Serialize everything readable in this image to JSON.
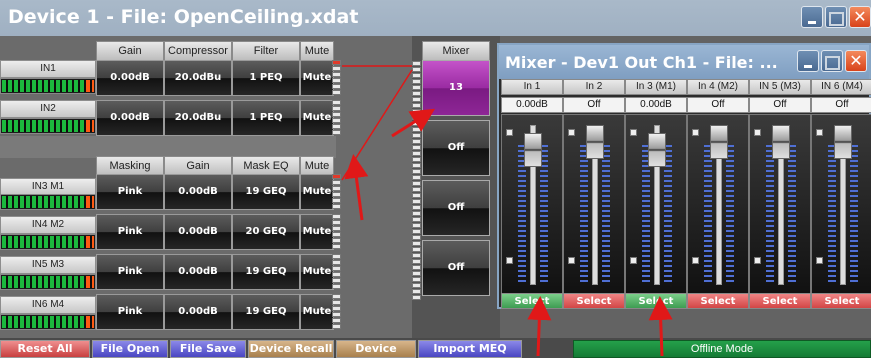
{
  "window": {
    "title": "Device 1  -  File: OpenCeiling.xdat"
  },
  "top_headers": {
    "gain": "Gain",
    "compressor": "Compressor",
    "filter": "Filter",
    "mute": "Mute",
    "mixer": "Mixer"
  },
  "mask_headers": {
    "masking": "Masking",
    "gain": "Gain",
    "mask_eq": "Mask EQ",
    "mute": "Mute"
  },
  "inputs": [
    {
      "name": "IN1",
      "gain": "0.00dB",
      "compressor": "20.0dBu",
      "filter": "1 PEQ",
      "mute": "Mute"
    },
    {
      "name": "IN2",
      "gain": "0.00dB",
      "compressor": "20.0dBu",
      "filter": "1 PEQ",
      "mute": "Mute"
    }
  ],
  "mask_inputs": [
    {
      "name": "IN3 M1",
      "masking": "Pink",
      "gain": "0.00dB",
      "mask_eq": "19 GEQ",
      "mute": "Mute"
    },
    {
      "name": "IN4 M2",
      "masking": "Pink",
      "gain": "0.00dB",
      "mask_eq": "20 GEQ",
      "mute": "Mute"
    },
    {
      "name": "IN5 M3",
      "masking": "Pink",
      "gain": "0.00dB",
      "mask_eq": "19 GEQ",
      "mute": "Mute"
    },
    {
      "name": "IN6 M4",
      "masking": "Pink",
      "gain": "0.00dB",
      "mask_eq": "19 GEQ",
      "mute": "Mute"
    }
  ],
  "mixer_cells": [
    "13",
    "Off",
    "Off",
    "Off"
  ],
  "mixer_window": {
    "title": "Mixer - Dev1 Out Ch1  -  File: ...",
    "strips": [
      {
        "name": "In 1",
        "value": "0.00dB",
        "select": "Select",
        "select_color": "green",
        "level": 0.9
      },
      {
        "name": "In 2",
        "value": "Off",
        "select": "Select",
        "select_color": "red",
        "level": 0.96
      },
      {
        "name": "In 3 (M1)",
        "value": "0.00dB",
        "select": "Select",
        "select_color": "green",
        "level": 0.9
      },
      {
        "name": "In 4 (M2)",
        "value": "Off",
        "select": "Select",
        "select_color": "red",
        "level": 0.96
      },
      {
        "name": "IN 5 (M3)",
        "value": "Off",
        "select": "Select",
        "select_color": "red",
        "level": 0.96
      },
      {
        "name": "IN 6 (M4)",
        "value": "Off",
        "select": "Select",
        "select_color": "red",
        "level": 0.96
      }
    ]
  },
  "bottom_bar": {
    "reset_all": "Reset All",
    "file_open": "File Open",
    "file_save": "File Save",
    "device_recall": "Device Recall",
    "device_store": "Device Store",
    "import_meq": "Import MEQ Data",
    "status": "Offline Mode"
  },
  "colors": {
    "select_green": "#3e9c52",
    "select_red": "#d24646",
    "active_cell": "#9a2ba2",
    "meter_green": "#1cb83d",
    "annotation_arrow": "#e01818"
  }
}
